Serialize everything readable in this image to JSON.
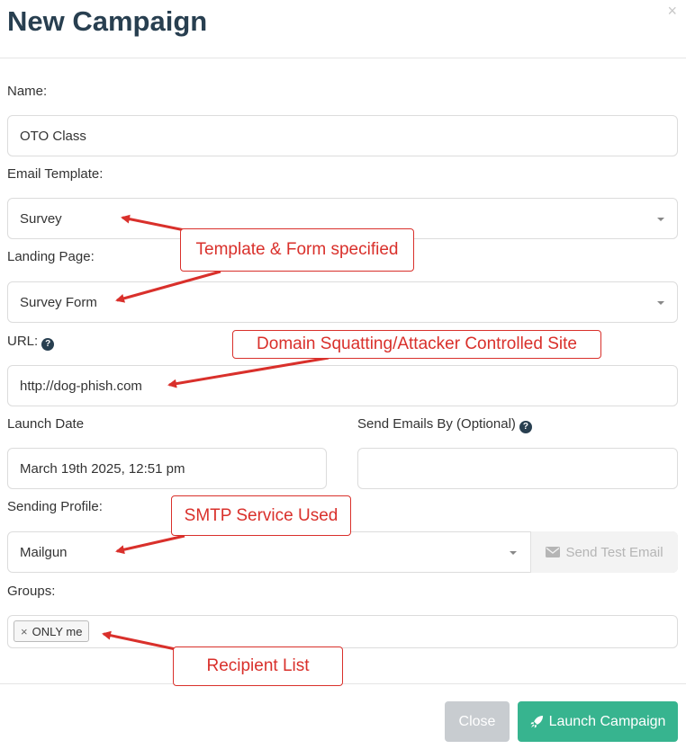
{
  "modal": {
    "title": "New Campaign",
    "close_glyph": "×"
  },
  "form": {
    "name_label": "Name:",
    "name_value": "OTO Class",
    "template_label": "Email Template:",
    "template_value": "Survey",
    "landing_label": "Landing Page:",
    "landing_value": "Survey Form",
    "url_label": "URL:",
    "url_value": "http://dog-phish.com",
    "launch_date_label": "Launch Date",
    "launch_date_value": "March 19th 2025, 12:51 pm",
    "send_by_label": "Send Emails By (Optional)",
    "send_by_value": "",
    "profile_label": "Sending Profile:",
    "profile_value": "Mailgun",
    "send_test_label": "Send Test Email",
    "groups_label": "Groups:",
    "groups": [
      {
        "remove_glyph": "×",
        "label": "ONLY me"
      }
    ]
  },
  "footer": {
    "close_label": "Close",
    "launch_label": "Launch Campaign"
  },
  "annotations": {
    "template_form": "Template & Form specified",
    "domain": "Domain Squatting/Attacker Controlled Site",
    "smtp": "SMTP Service Used",
    "recipients": "Recipient List"
  },
  "icons": {
    "help": "question-circle-icon",
    "envelope": "envelope-icon",
    "rocket": "rocket-icon"
  },
  "colors": {
    "title": "#283f50",
    "launch_button": "#37b48f",
    "close_button": "#c8ccd0",
    "annotation": "#d9302b"
  }
}
